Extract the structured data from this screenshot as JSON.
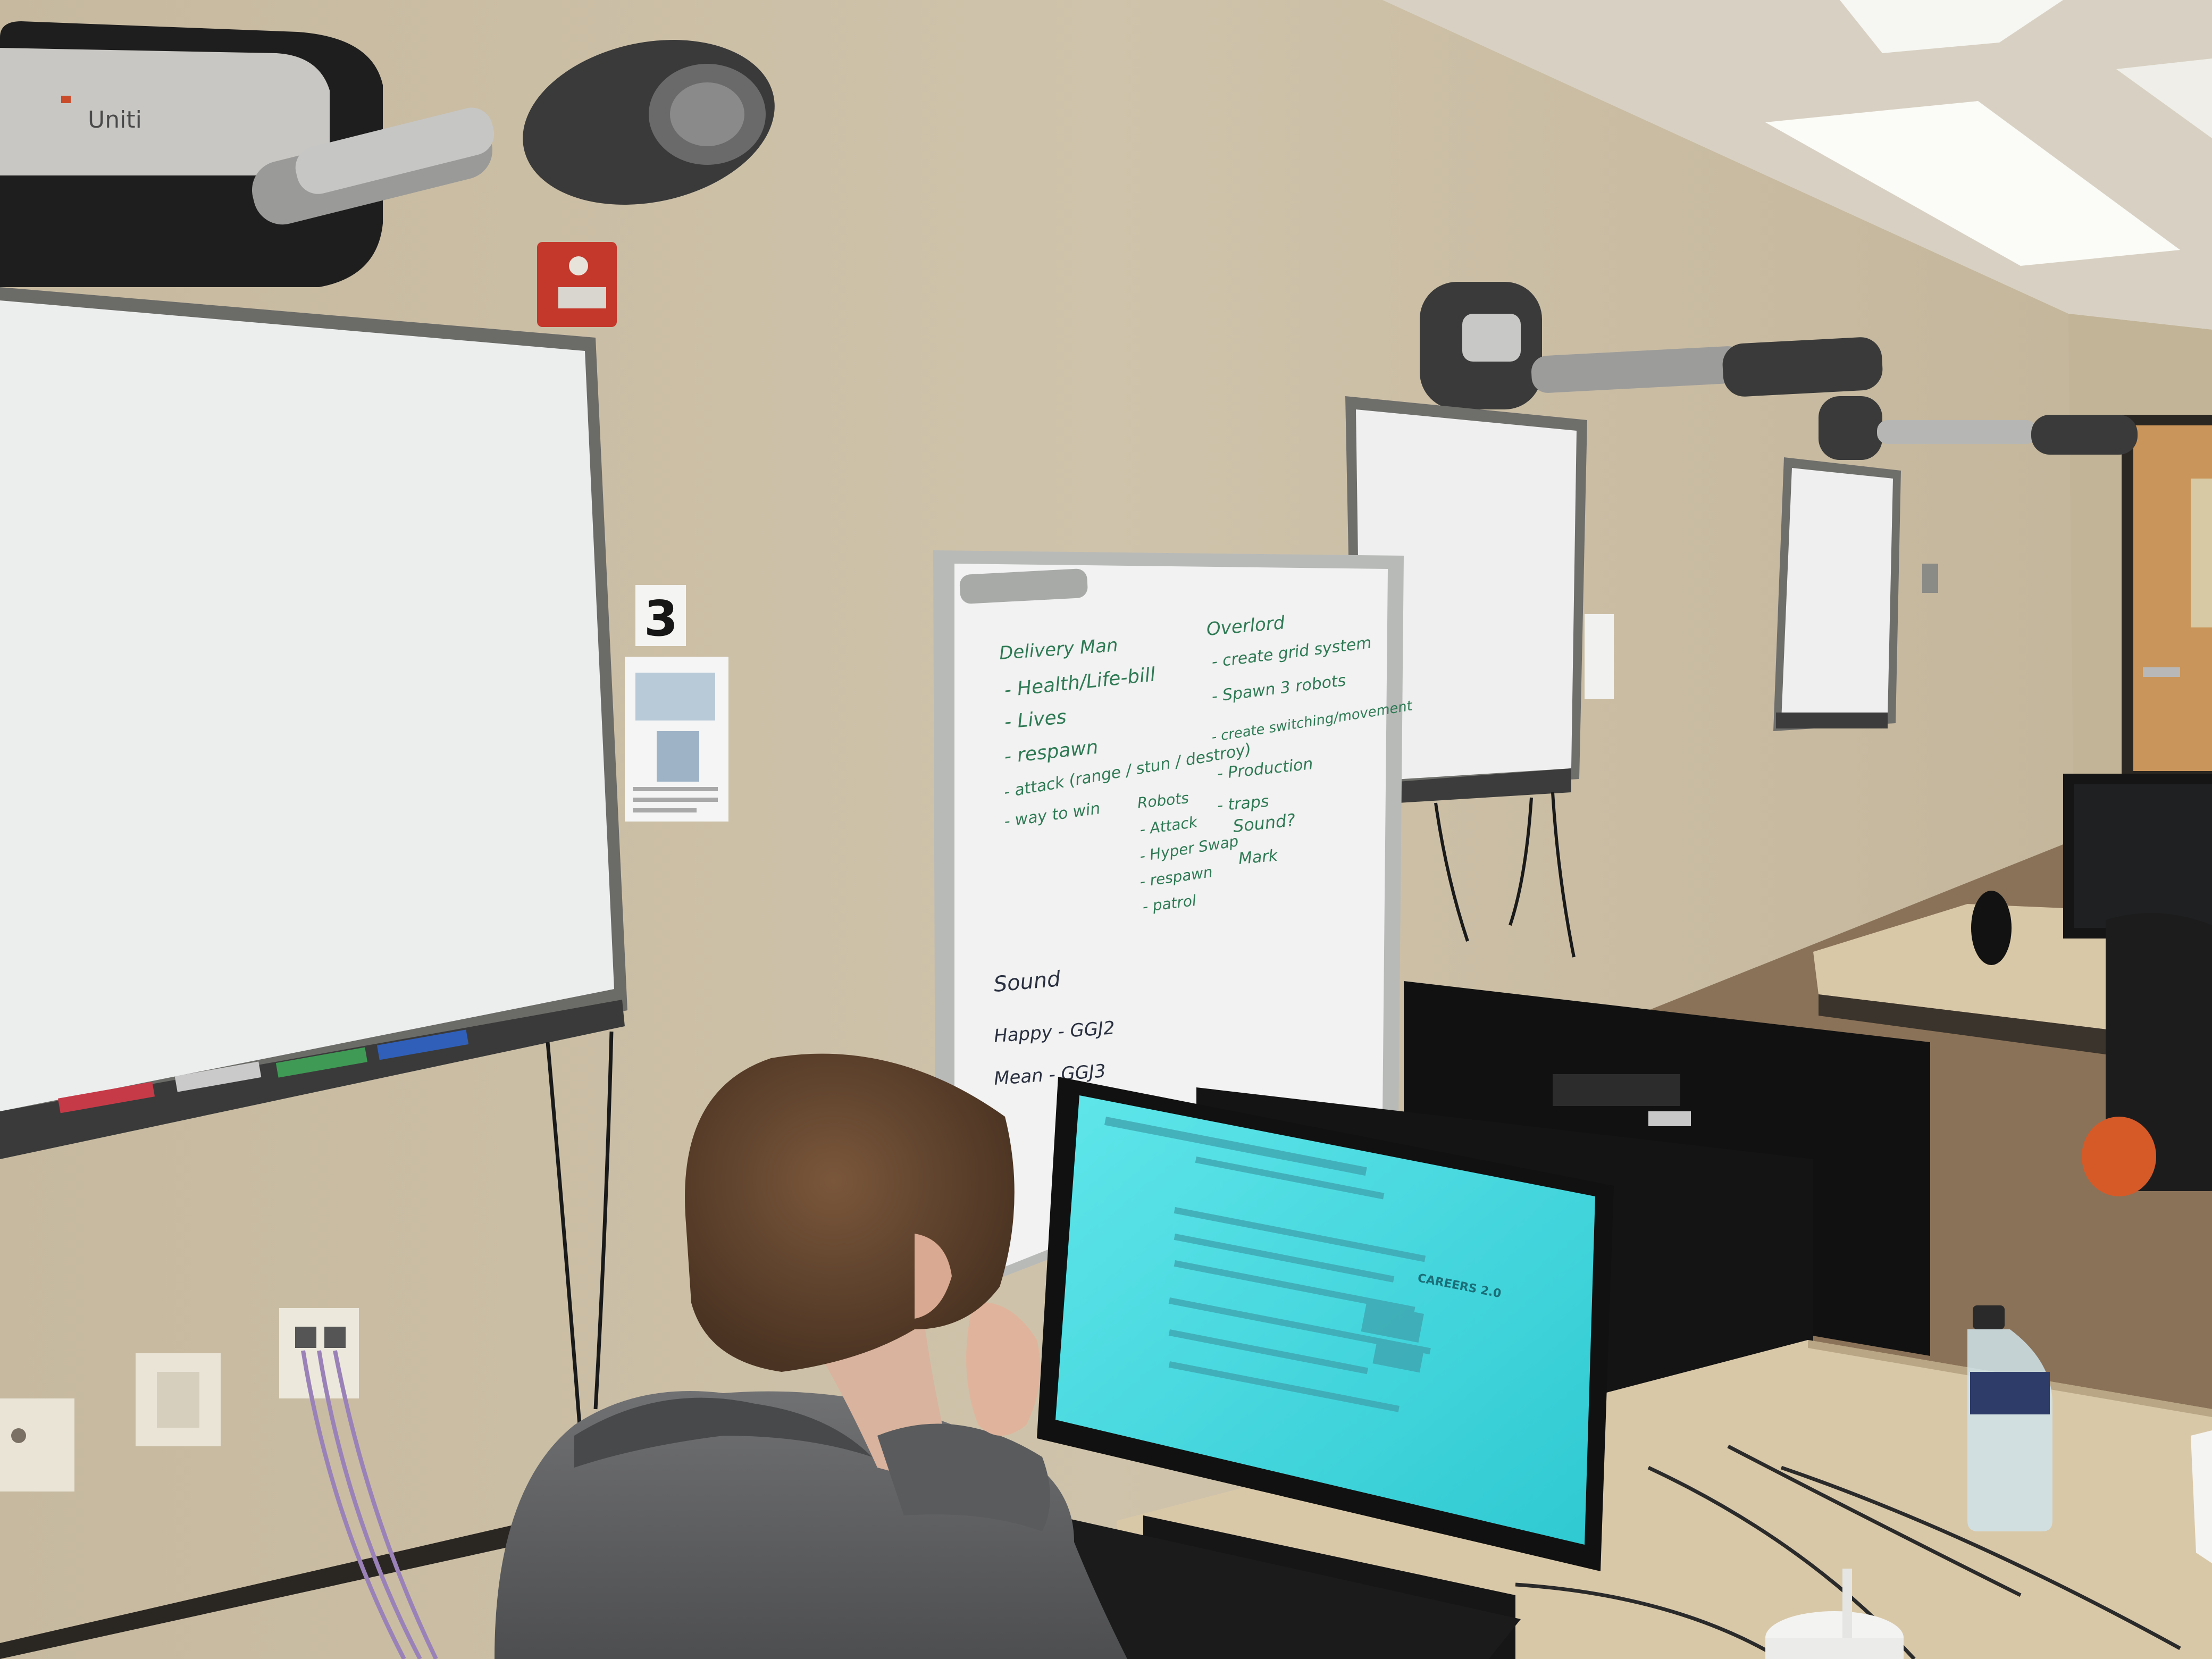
{
  "scene": {
    "room_number": "3",
    "projector_brand": "Uniti",
    "colors": {
      "wall": "#cbbfa8",
      "ceiling": "#d8d1c3",
      "whiteboard": "#eef0ef",
      "marker_green": "#2f7a55",
      "marker_dark": "#2a3040",
      "screen": "#3fd8df",
      "hoodie": "#5f6062",
      "hair": "#6a4a32",
      "desk": "#d9c8a8",
      "door": "#c9955a",
      "fire_alarm": "#c4382c"
    },
    "whiteboard_notes": {
      "left_column": [
        "Delivery Man",
        "- Health/Life-bill",
        "- Lives",
        "- respawn",
        "- attack (range / stun / destroy)",
        "- way to win"
      ],
      "right_column": [
        "Overlord",
        "- create grid system",
        "- Spawn 3 robots",
        "- create switching/movement",
        "- Production",
        "- traps"
      ],
      "robots": [
        "Robots",
        "- Attack",
        "- Hyper Swap",
        "- respawn",
        "- patrol"
      ],
      "sound_question": [
        "Sound?",
        "Mark"
      ],
      "sound_list": [
        "Sound",
        "Happy - GGJ2",
        "Mean - GGJ3"
      ]
    },
    "monitor_screen": {
      "sidebar_header": "CAREERS 2.0"
    }
  }
}
